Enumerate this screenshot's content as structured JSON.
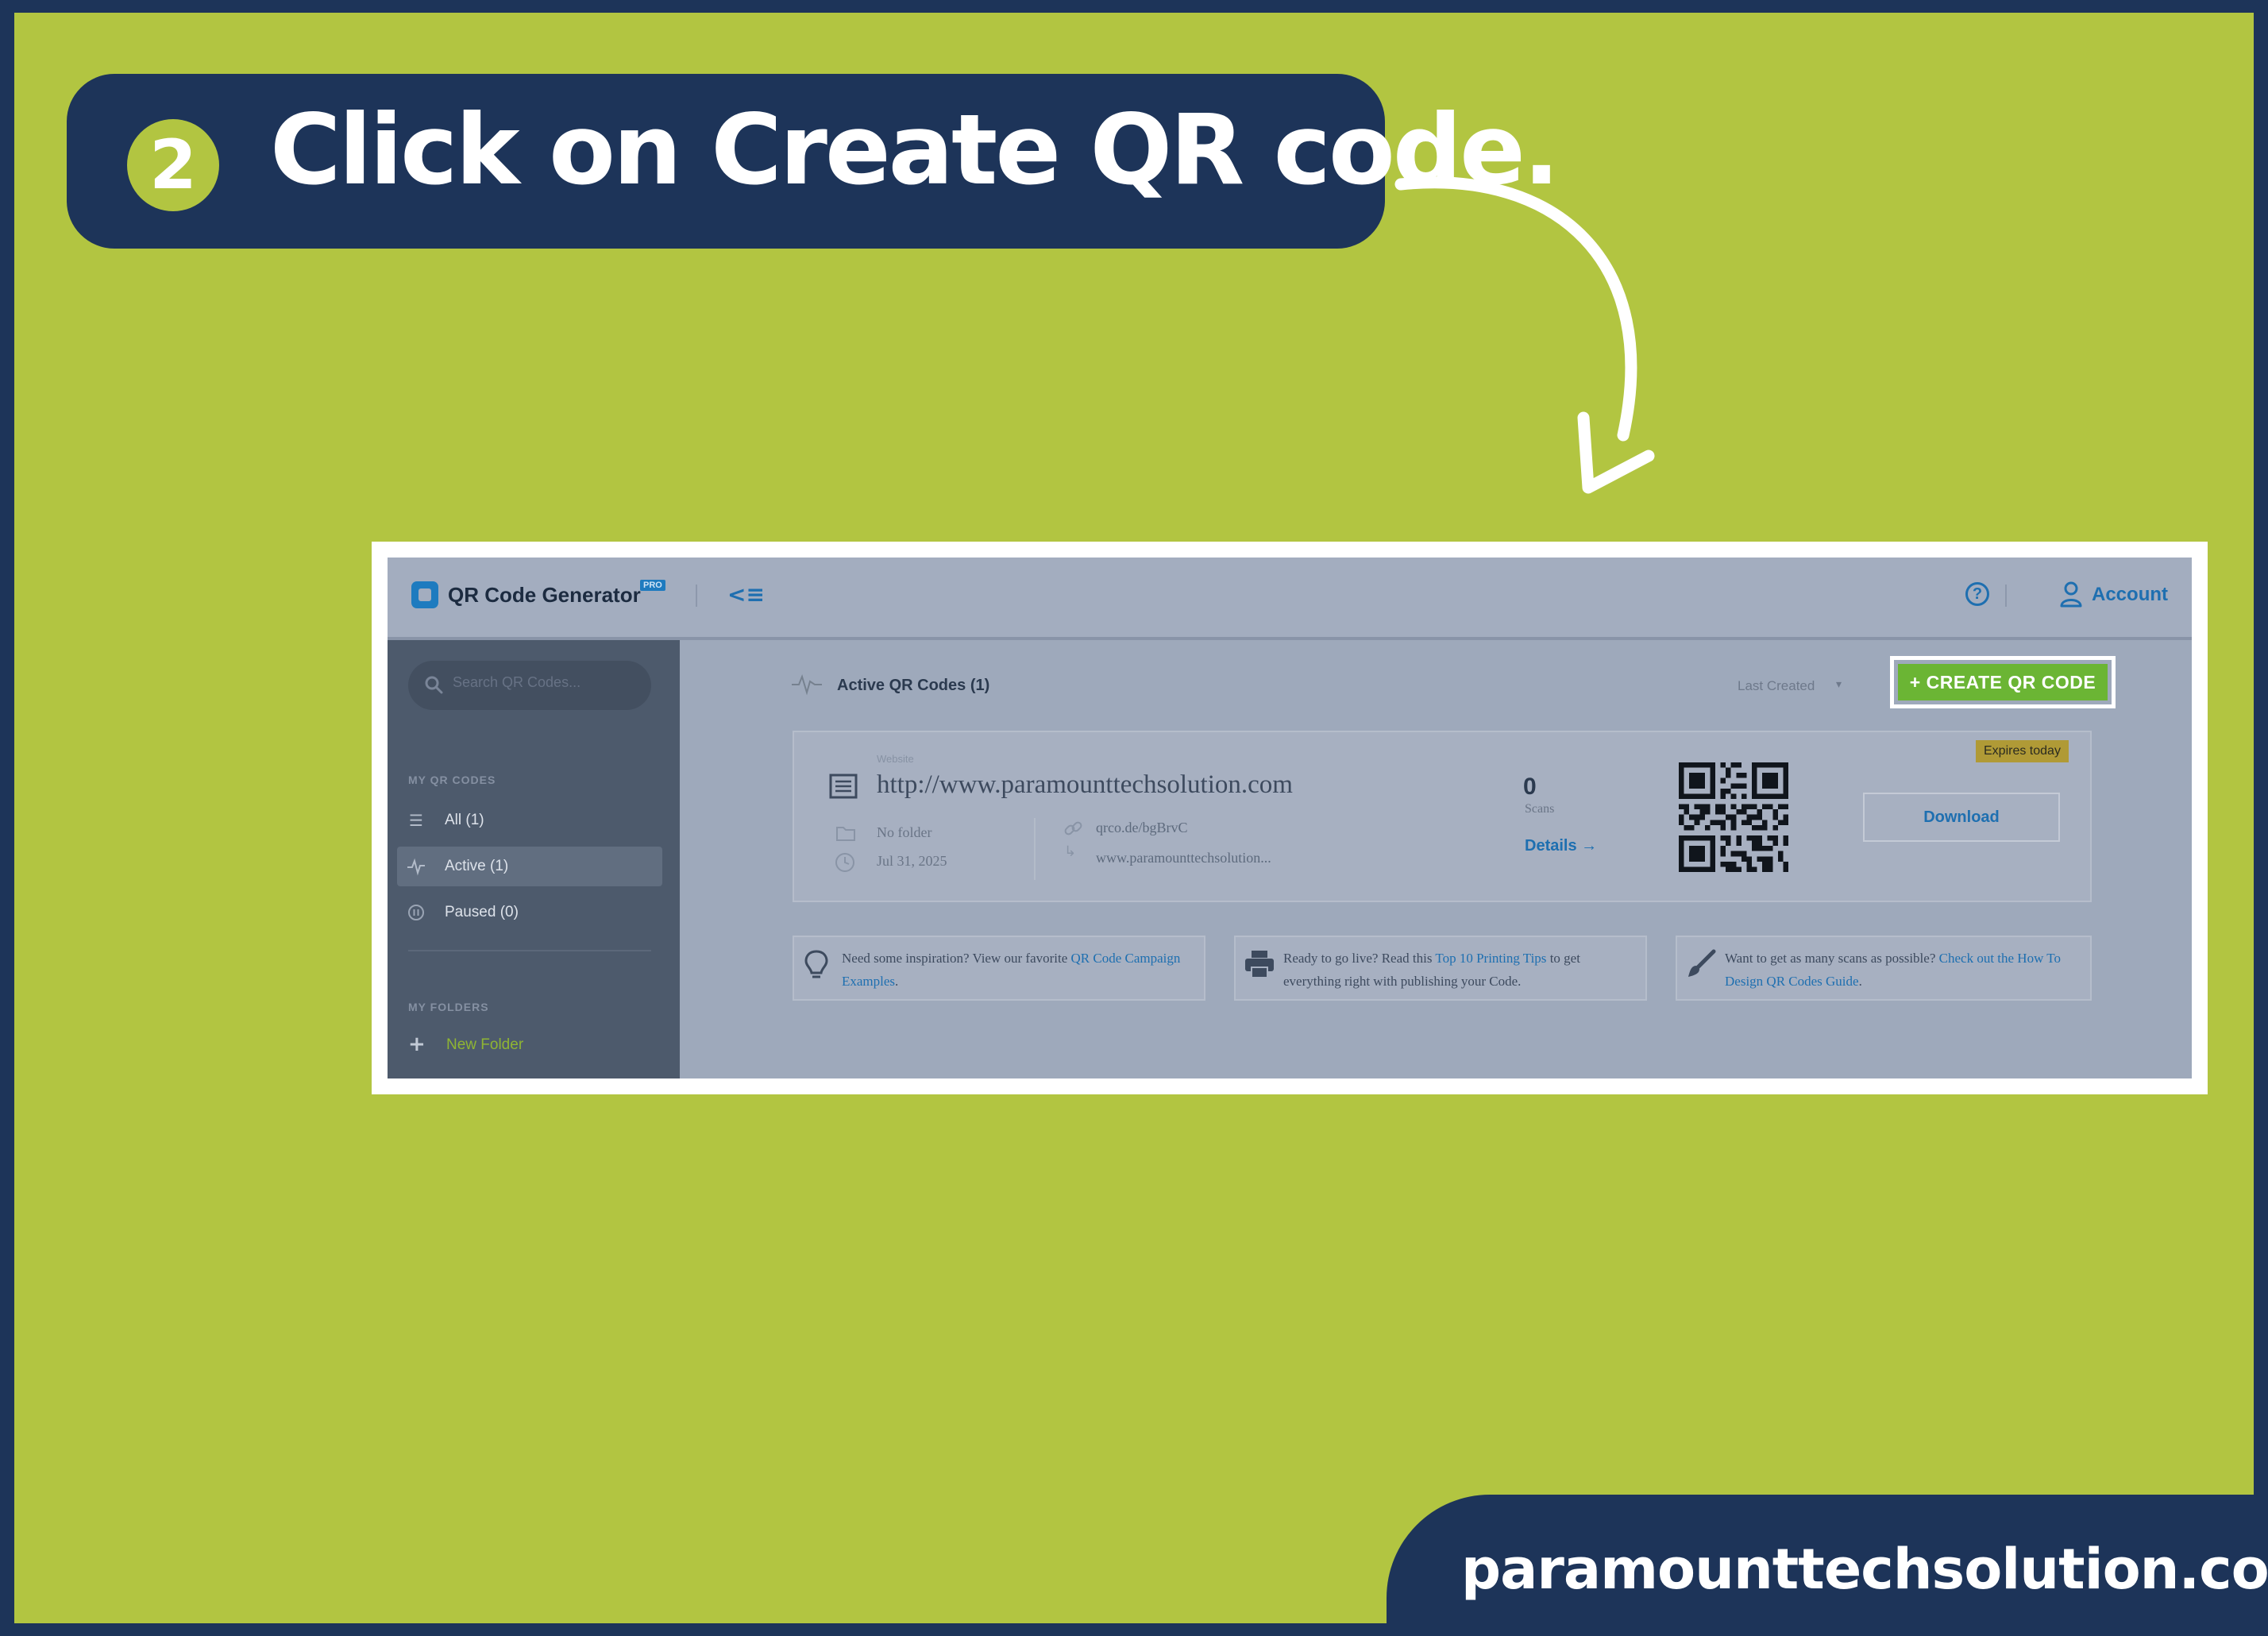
{
  "banner": {
    "step_number": "2",
    "title": "Click on Create QR code."
  },
  "footer": {
    "site": "paramounttechsolution.com"
  },
  "colors": {
    "navy": "#1d3459",
    "lime": "#b2c541",
    "cta_green": "#6bb534",
    "link_blue": "#1e6fb0"
  },
  "app": {
    "brand": "QR Code Generator",
    "brand_badge": "PRO",
    "topbar": {
      "collapse_icon": "collapse-menu-icon",
      "help_icon": "help-icon",
      "account_label": "Account"
    },
    "sidebar": {
      "search_placeholder": "Search QR Codes...",
      "section_my_codes": "MY QR CODES",
      "items": [
        {
          "label": "All (1)",
          "icon": "list-icon"
        },
        {
          "label": "Active (1)",
          "icon": "pulse-icon",
          "active": true
        },
        {
          "label": "Paused (0)",
          "icon": "pause-icon"
        }
      ],
      "section_folders": "MY FOLDERS",
      "new_folder_label": "New Folder"
    },
    "main": {
      "heading": "Active QR Codes  (1)",
      "sort_label": "Last Created",
      "create_button": "+  CREATE QR CODE"
    },
    "card": {
      "type": "Website",
      "url": "http://www.paramounttechsolution.com",
      "folder": "No folder",
      "date": "Jul 31, 2025",
      "short_url": "qrco.de/bgBrvC",
      "destination": "www.paramounttechsolution...",
      "scans": "0",
      "scans_label": "Scans",
      "details_label": "Details →",
      "expires_badge": "Expires today",
      "download_label": "Download"
    },
    "tips": [
      {
        "before": "Need some inspiration? View our favorite ",
        "link": "QR Code Campaign Examples",
        "after": "."
      },
      {
        "before": "Ready to go live? Read this ",
        "link": "Top 10 Printing Tips",
        "after": " to get everything right with publishing your Code."
      },
      {
        "before": "Want to get as many scans as possible? ",
        "link": "Check out the How To Design QR Codes Guide",
        "after": "."
      }
    ]
  }
}
